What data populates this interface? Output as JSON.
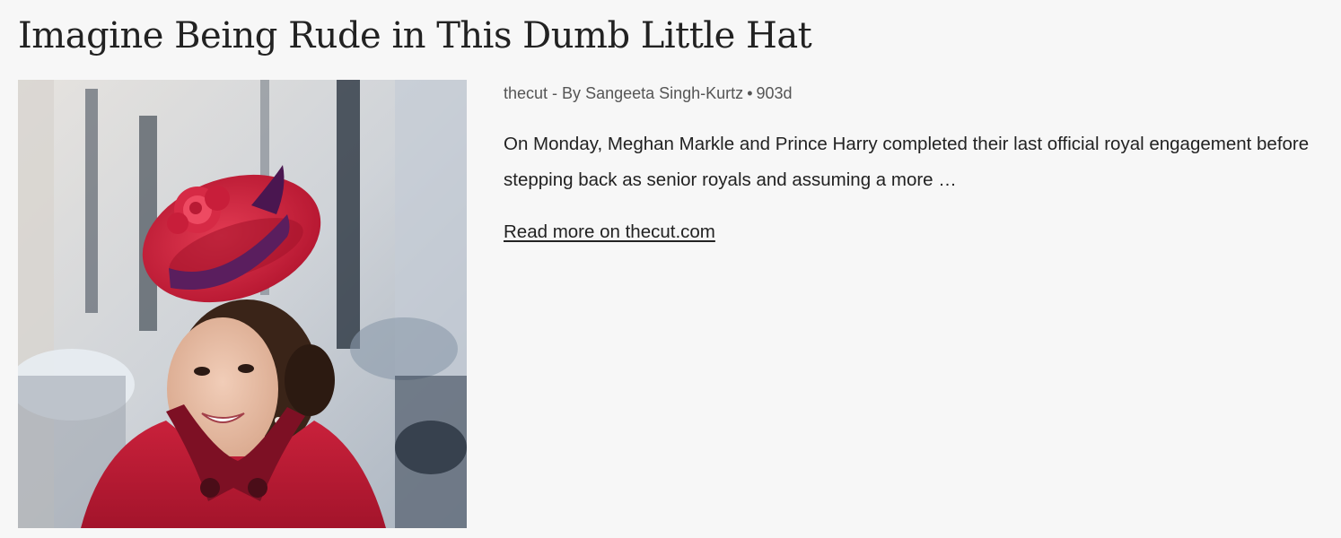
{
  "article": {
    "title": "Imagine Being Rude in This Dumb Little Hat",
    "source": "thecut",
    "byline_separator": " - By ",
    "author": "Sangeeta Singh-Kurtz",
    "dot": "•",
    "age": "903d",
    "summary": "On Monday, Meghan Markle and Prince Harry completed their last official royal engagement before stepping back as senior royals and assuming a more …",
    "read_more": "Read more on thecut.com"
  },
  "colors": {
    "background": "#f7f7f7",
    "text": "#222222",
    "meta_text": "#555555",
    "hat_red": "#c81e3a",
    "coat_red": "#b3192f",
    "ribbon_purple": "#5a1e5e"
  }
}
